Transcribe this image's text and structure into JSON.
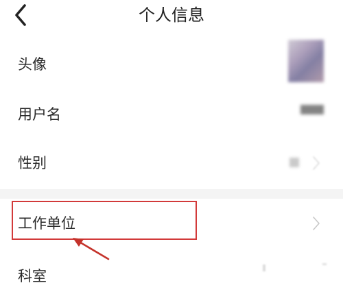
{
  "header": {
    "title": "个人信息",
    "back_icon": "chevron-left-icon"
  },
  "rows": {
    "avatar": {
      "label": "头像"
    },
    "username": {
      "label": "用户名"
    },
    "gender": {
      "label": "性别"
    },
    "work_unit": {
      "label": "工作单位"
    },
    "department": {
      "label": "科室"
    }
  },
  "icons": {
    "row_chevron": "chevron-right-icon",
    "annotation": "red-arrow-icon"
  },
  "colors": {
    "highlight": "#d23a3a",
    "section_gap": "#f4f4f4",
    "chevron": "#c8c8c8"
  }
}
